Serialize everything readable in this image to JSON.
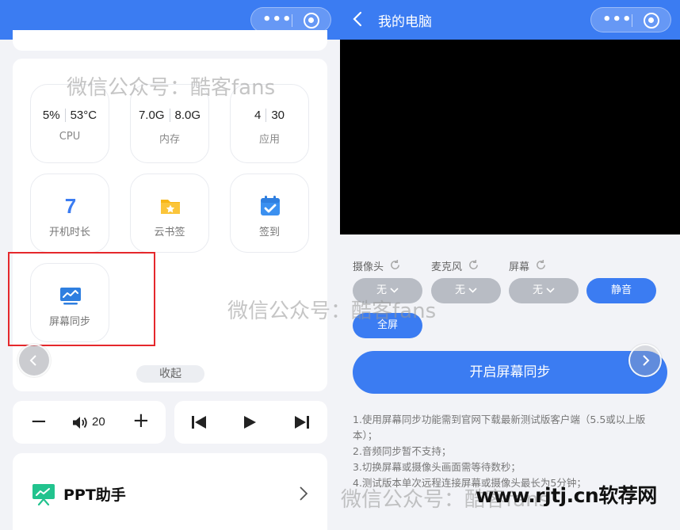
{
  "left": {
    "stats": [
      {
        "values": [
          "5%",
          "53°C"
        ],
        "label": "CPU"
      },
      {
        "values": [
          "7.0G",
          "8.0G"
        ],
        "label": "内存"
      },
      {
        "values": [
          "4",
          "30"
        ],
        "label": "应用"
      }
    ],
    "features": [
      {
        "label": "开机时长",
        "icon": "power-on-time-icon",
        "number": "7"
      },
      {
        "label": "云书签",
        "icon": "folder-star-icon"
      },
      {
        "label": "签到",
        "icon": "calendar-check-icon"
      },
      {
        "label": "屏幕同步",
        "icon": "monitor-sync-icon"
      }
    ],
    "collapse_label": "收起",
    "volume": {
      "value": "20",
      "minus": "−",
      "plus": "+"
    },
    "ppt": {
      "label": "PPT助手"
    }
  },
  "right": {
    "title": "我的电脑",
    "selectors": [
      {
        "label": "摄像头",
        "value": "无"
      },
      {
        "label": "麦克风",
        "value": "无"
      },
      {
        "label": "屏幕",
        "value": "无"
      }
    ],
    "mute_label": "静音",
    "fullscreen_label": "全屏",
    "start_label": "开启屏幕同步",
    "notes": [
      "1.使用屏幕同步功能需到官网下载最新测试版客户端（5.5或以上版本）；",
      "2.音频同步暂不支持；",
      "3.切换屏幕或摄像头画面需等待数秒；",
      "4.测试版本单次远程连接屏幕或摄像头最长为5分钟；"
    ]
  },
  "watermarks": {
    "wm1": "微信公众号：酷客fans",
    "wm2": "微信公众号：酷客fans",
    "wm3": "微信公众号：酷客fans",
    "brand": "www.rjtj.cn软荐网"
  },
  "colors": {
    "accent": "#3b7cf2",
    "highlight": "#e5282c"
  }
}
